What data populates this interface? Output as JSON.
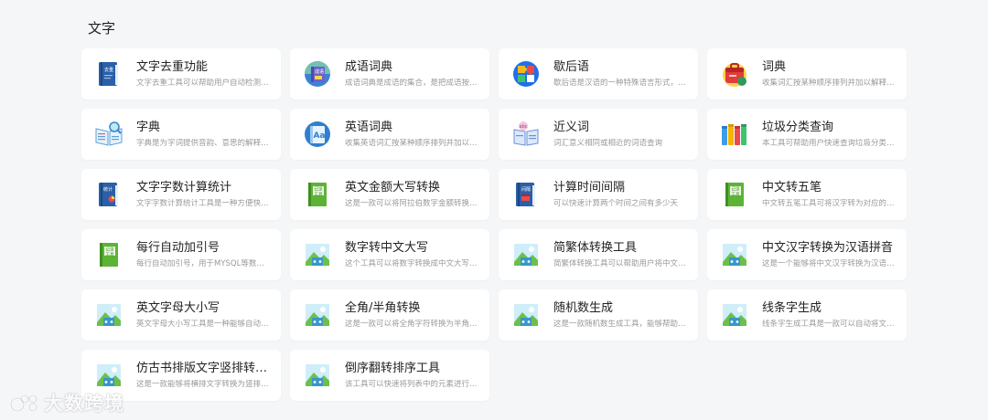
{
  "section": {
    "title": "文字"
  },
  "tools": [
    {
      "title": "文字去重功能",
      "desc": "文字去重工具可以帮助用户自动检测和删除...",
      "icon": "book-blue-icon"
    },
    {
      "title": "成语词典",
      "desc": "成语词典是成语的集合，是把成语按某种顺...",
      "icon": "globe-book-icon"
    },
    {
      "title": "歇后语",
      "desc": "歇后语是汉语的一种特殊语言形式，是群众...",
      "icon": "puzzle-icon"
    },
    {
      "title": "词典",
      "desc": "收集词汇按某种顺序排列并加以解释供人检...",
      "icon": "bag-icon"
    },
    {
      "title": "字典",
      "desc": "字典是为字词提供音韵、意思的解释、例句...",
      "icon": "open-book-magnifier-icon"
    },
    {
      "title": "英语词典",
      "desc": "收集英语词汇按某种顺序排列并加以解释供...",
      "icon": "aa-book-icon"
    },
    {
      "title": "近义词",
      "desc": "词汇意义相同或相近的词语查询",
      "icon": "abc-book-icon"
    },
    {
      "title": "垃圾分类查询",
      "desc": "本工具可帮助用户快速查询垃圾分类信息。...",
      "icon": "trash-bins-icon"
    },
    {
      "title": "文字字数计算统计",
      "desc": "文字字数计算统计工具是一种方便快捷的工...",
      "icon": "stats-book-icon"
    },
    {
      "title": "英文金额大写转换",
      "desc": "这是一款可以将阿拉伯数字金额转换为中文...",
      "icon": "notebook-green-icon"
    },
    {
      "title": "计算时间间隔",
      "desc": "可以快速计算两个时间之间有多少天",
      "icon": "calendar-book-icon"
    },
    {
      "title": "中文转五笔",
      "desc": "中文转五笔工具可将汉字转为对应的五笔编...",
      "icon": "notebook-green-icon"
    },
    {
      "title": "每行自动加引号",
      "desc": "每行自动加引号，用于MYSQL等数据库的IN...",
      "icon": "notebook-green-icon"
    },
    {
      "title": "数字转中文大写",
      "desc": "这个工具可以将数字转换成中文大写形式，...",
      "icon": "picture-icon"
    },
    {
      "title": "简繁体转换工具",
      "desc": "简繁体转换工具可以帮助用户将中文文章从...",
      "icon": "picture-icon"
    },
    {
      "title": "中文汉字转换为汉语拼音",
      "desc": "这是一个能够将中文汉字转换为汉语拼音的...",
      "icon": "picture-icon"
    },
    {
      "title": "英文字母大小写",
      "desc": "英文字母大小写工具是一种能够自动将英文...",
      "icon": "picture-icon"
    },
    {
      "title": "全角/半角转换",
      "desc": "这是一款可以将全角字符转换为半角字符，...",
      "icon": "picture-icon"
    },
    {
      "title": "随机数生成",
      "desc": "这是一款随机数生成工具，能够帮助用户快...",
      "icon": "picture-icon"
    },
    {
      "title": "线条字生成",
      "desc": "线条字生成工具是一款可以自动将文字转化...",
      "icon": "picture-icon"
    },
    {
      "title": "仿古书排版文字竖排转换工...",
      "desc": "这是一款能够将横排文字转换为竖排文字的...",
      "icon": "picture-icon"
    },
    {
      "title": "倒序翻转排序工具",
      "desc": "该工具可以快速将列表中的元素进行倒序翻...",
      "icon": "picture-icon"
    }
  ],
  "icon_labels": {
    "book_blue": "去重",
    "globe_book": "成语",
    "stats_book": "统计",
    "notebook_green": "记录\n工具",
    "calendar_book": "间隔"
  },
  "watermark": {
    "text": "大数跨境"
  },
  "colors": {
    "background": "#f5f6f8",
    "card": "#ffffff",
    "title": "#222222",
    "desc": "#9a9a9a"
  }
}
